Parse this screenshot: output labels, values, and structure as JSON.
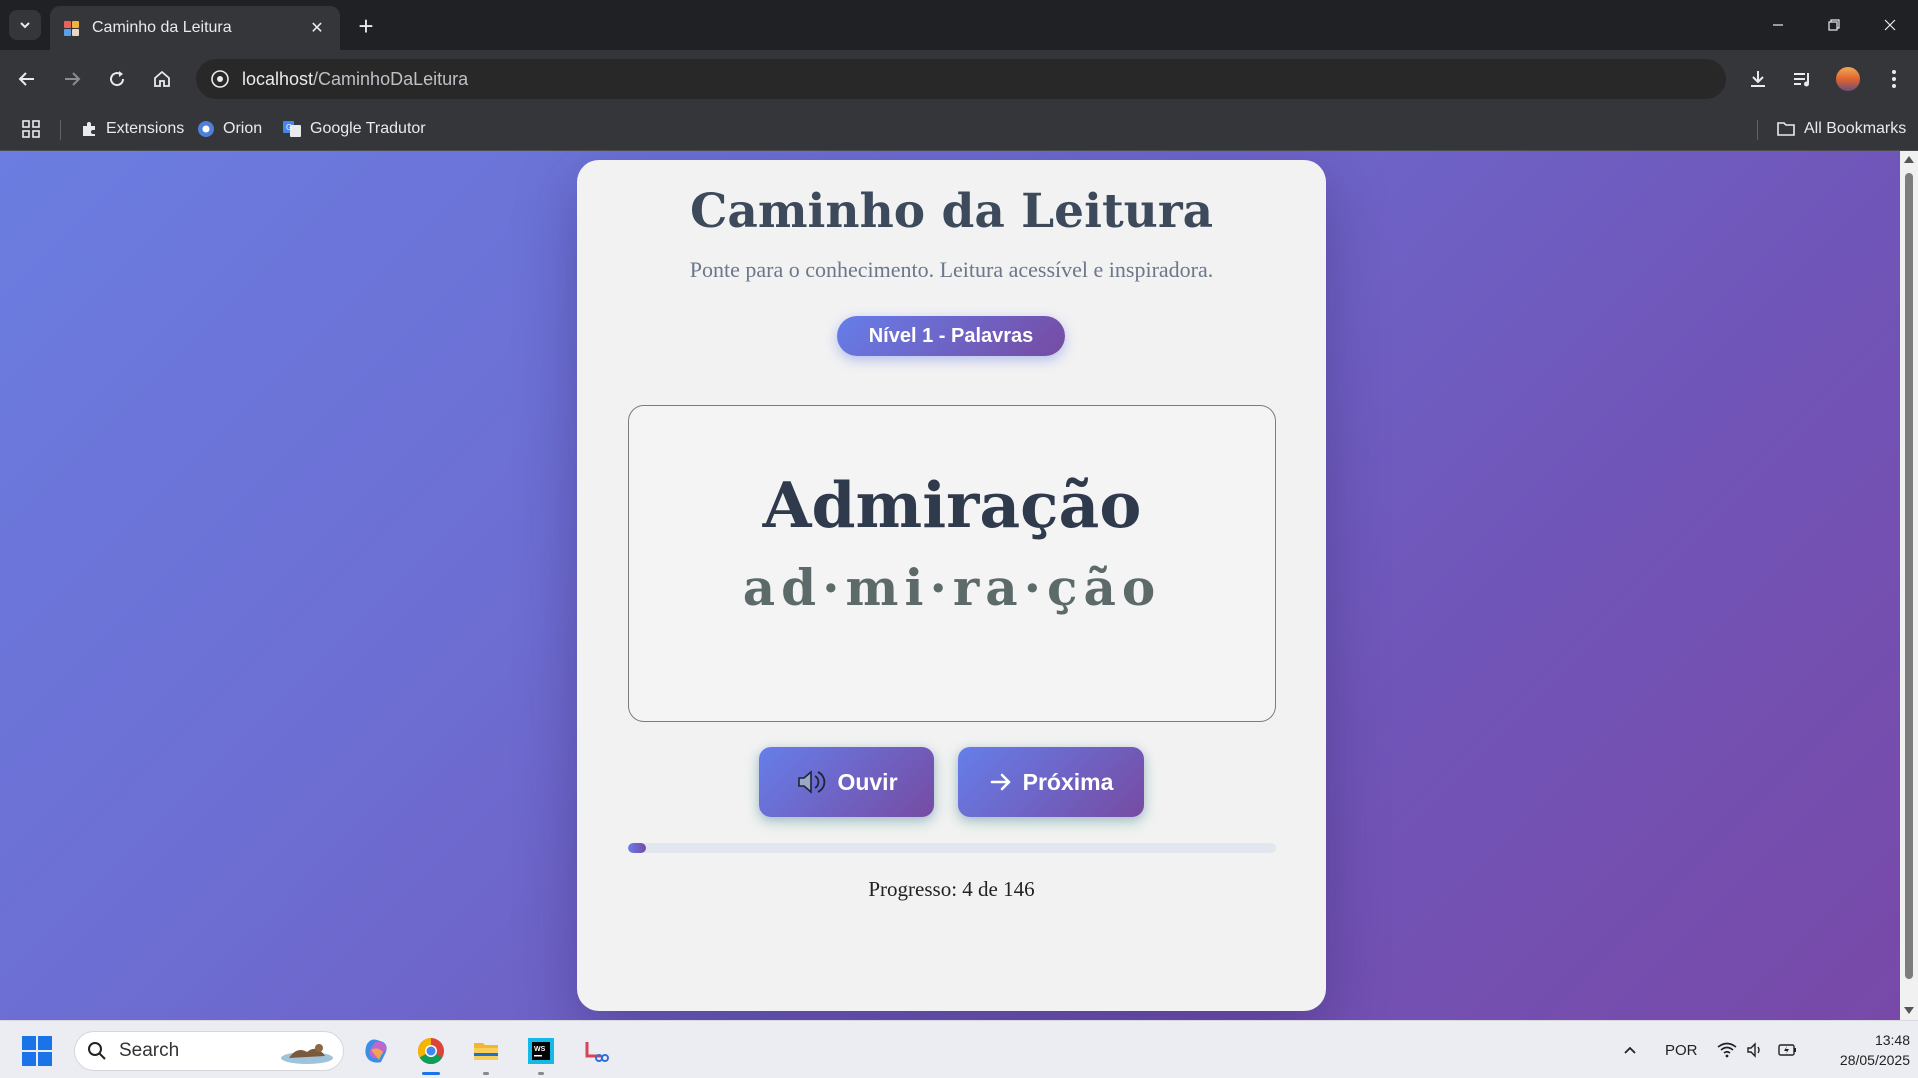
{
  "browser": {
    "tab_title": "Caminho da Leitura",
    "url_host": "localhost",
    "url_path": "/CaminhoDaLeitura",
    "bookmarks": [
      {
        "label": "Extensions",
        "icon": "puzzle-icon"
      },
      {
        "label": "Orion",
        "icon": "orion-icon"
      },
      {
        "label": "Google Tradutor",
        "icon": "translate-icon"
      }
    ],
    "all_bookmarks_label": "All Bookmarks"
  },
  "page": {
    "title": "Caminho da Leitura",
    "subtitle": "Ponte para o conhecimento. Leitura acessível e inspiradora.",
    "level_badge": "Nível 1 - Palavras",
    "word": "Admiração",
    "syllables": "ad·mi·ra·ção",
    "listen_button": "Ouvir",
    "next_button": "Próxima",
    "progress": {
      "current": 4,
      "total": 146,
      "label": "Progresso: 4 de 146"
    },
    "colors": {
      "accent_start": "#667eea",
      "accent_end": "#764ba2"
    }
  },
  "taskbar": {
    "search_placeholder": "Search",
    "language": "POR",
    "time": "13:48",
    "date": "28/05/2025",
    "apps": [
      "copilot-icon",
      "chrome-icon",
      "file-explorer-icon",
      "webstorm-icon",
      "snipping-tool-icon"
    ]
  }
}
